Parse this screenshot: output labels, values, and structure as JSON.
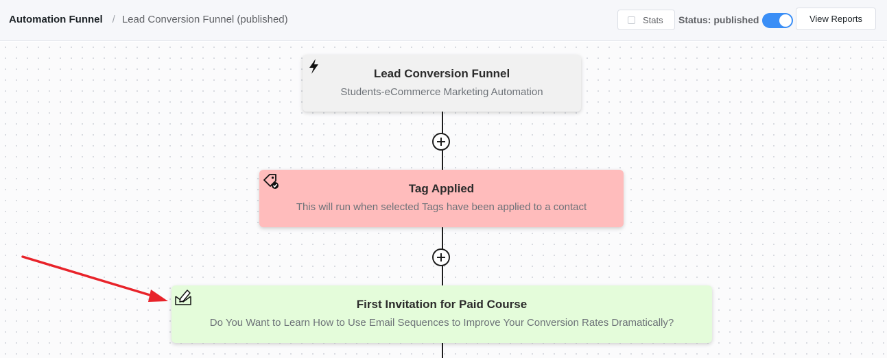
{
  "breadcrumb": {
    "root": "Automation Funnel",
    "separator": "/",
    "current": "Lead Conversion Funnel (published)"
  },
  "toolbar": {
    "stats_label": "Stats",
    "stats_checked": false,
    "status_label": "Status: published",
    "status_on": true,
    "view_reports_label": "View Reports"
  },
  "colors": {
    "accent": "#3a8ef6",
    "trigger_node_bg": "#f1f1f1",
    "tag_node_bg": "#ffbcbc",
    "email_node_bg": "#e4fcda",
    "annotation_arrow": "#e8232a"
  },
  "funnel": {
    "trigger": {
      "icon": "lightning-icon",
      "title": "Lead Conversion Funnel",
      "subtitle": "Students-eCommerce Marketing Automation"
    },
    "tag_applied": {
      "icon": "tag-check-icon",
      "title": "Tag Applied",
      "subtitle": "This will run when selected Tags have been applied to a contact"
    },
    "email": {
      "icon": "email-edit-icon",
      "title": "First Invitation for Paid Course",
      "subtitle": "Do You Want to Learn How to Use Email Sequences to Improve Your Conversion Rates Dramatically?"
    }
  }
}
